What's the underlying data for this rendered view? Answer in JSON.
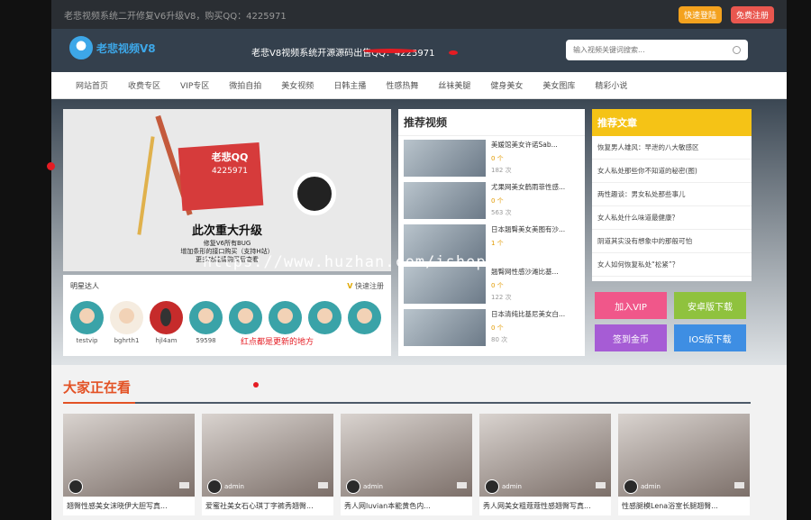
{
  "topbar": {
    "text": "老悲视频系统二开修复V6升级V8，购买QQ：4225971",
    "login": "快速登陆",
    "register": "免费注册"
  },
  "header": {
    "logo": "老悲视频V8",
    "slogan": "老悲V8视频系统开源源码出售QQ：4225971",
    "search_placeholder": "输入视频关键词搜索..."
  },
  "nav": [
    "网站首页",
    "收费专区",
    "VIP专区",
    "微拍自拍",
    "美女视频",
    "日韩主播",
    "性感热舞",
    "丝袜美腿",
    "健身美女",
    "美女图库",
    "精彩小说"
  ],
  "banner": {
    "title": "老悲QQ",
    "qq": "4225971",
    "headline": "此次重大升级",
    "lines": [
      "修复V6所有BUG",
      "增加条形的接口购买（支持H站）",
      "更多功能请购买后查看"
    ]
  },
  "watermark": "https://www.huzhan.com/ishop9031",
  "stars": {
    "title": "明星达人",
    "register": "快速注册",
    "users": [
      "testvip",
      "bghrth1",
      "hjl4am",
      "59598",
      "",
      "",
      "",
      ""
    ]
  },
  "stars_note": "红点都是更新的地方",
  "recommend": {
    "title": "推荐视频",
    "items": [
      {
        "title": "美媛馆美女许诺Sab...",
        "coins": "0 个",
        "views": "182 次"
      },
      {
        "title": "尤果网美女鹤雨菲性感...",
        "coins": "0 个",
        "views": "563 次"
      },
      {
        "title": "日本翘臀美女美图有沙...",
        "coins": "1 个",
        "views": ""
      },
      {
        "title": "翘臀网性感沙滩比基...",
        "coins": "0 个",
        "views": "122 次"
      },
      {
        "title": "日本清纯比基尼美女白...",
        "coins": "0 个",
        "views": "80 次"
      }
    ]
  },
  "articles": {
    "title": "推荐文章",
    "items": [
      "恢复男人雄风：早泄的八大敏感区",
      "女人私处那些你不知道的秘密(图)",
      "两性趣谈：男女私处那些事儿",
      "女人私处什么味道最健康？",
      "阴道其实没有想象中的那般可怕",
      "女人如何恢复私处“松紧”？"
    ]
  },
  "tiles": {
    "vip": "加入VIP",
    "android": "安卓版下载",
    "sign": "签到金币",
    "ios": "IOS版下载"
  },
  "watching": {
    "title": "大家正在看",
    "cards": [
      {
        "title": "翘臀性感美女沫晓伊大胆写真...",
        "user": ""
      },
      {
        "title": "爱蜜社美女石心琪丁字裤秀翘臀...",
        "user": "admin"
      },
      {
        "title": "秀人网luvian本能黄色内...",
        "user": "admin"
      },
      {
        "title": "秀人网美女粗蔻蔻性感翘臀写真...",
        "user": "admin"
      },
      {
        "title": "性感腿模Lena浴室长腿翘臀...",
        "user": "admin"
      }
    ]
  }
}
